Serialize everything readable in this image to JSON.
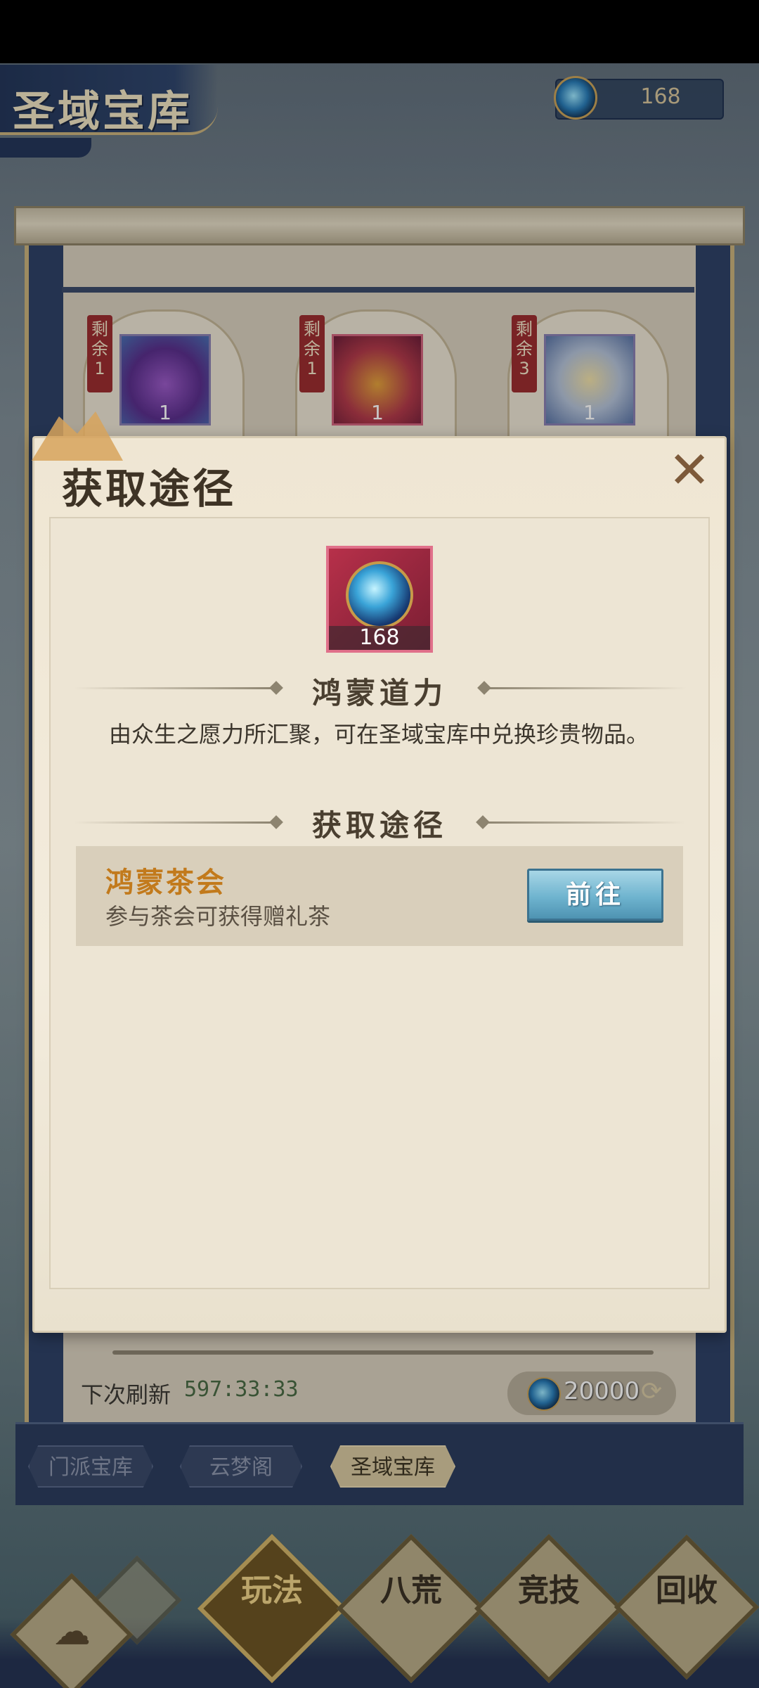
{
  "header": {
    "title": "圣域宝库",
    "currency_value": "168"
  },
  "rewards": [
    {
      "remain_label": "剩余1",
      "count": "1"
    },
    {
      "remain_label": "剩余1",
      "count": "1"
    },
    {
      "remain_label": "剩余3",
      "count": "1"
    }
  ],
  "footer": {
    "refresh_label": "下次刷新",
    "refresh_time": "597:33:33",
    "cost_value": "20000"
  },
  "tabs": [
    {
      "label": "门派宝库"
    },
    {
      "label": "云梦阁"
    },
    {
      "label": "圣域宝库"
    }
  ],
  "nav": [
    {
      "label": "玩法"
    },
    {
      "label": "八荒"
    },
    {
      "label": "竞技"
    },
    {
      "label": "回收"
    }
  ],
  "modal": {
    "title": "获取途径",
    "close_icon": "✕",
    "item": {
      "name": "鸿蒙道力",
      "count": "168",
      "description": "由众生之愿力所汇聚，可在圣域宝库中兑换珍贵物品。"
    },
    "section_heading": "获取途径",
    "sources": [
      {
        "title": "鸿蒙茶会",
        "description": "参与茶会可获得赠礼茶",
        "button": "前往"
      }
    ]
  },
  "colors": {
    "accent_gold": "#c27a1c",
    "button_blue": "#6fb4cf",
    "frame_navy": "#2f4267"
  }
}
